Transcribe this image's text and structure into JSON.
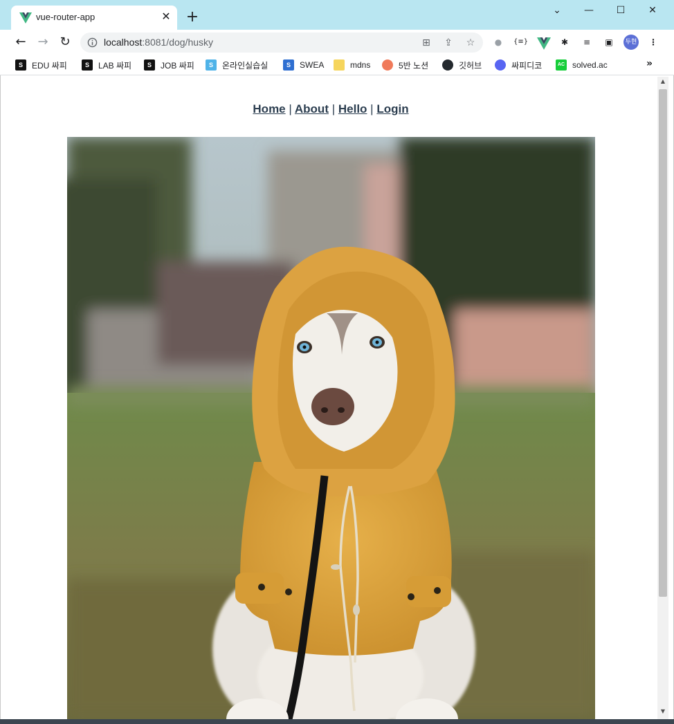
{
  "browser": {
    "tab": {
      "title": "vue-router-app",
      "close_label": "✕"
    },
    "new_tab_label": "+",
    "window_controls": {
      "minimize": "—",
      "maximize": "☐",
      "close": "✕",
      "dropdown": "⌄"
    },
    "url": {
      "host": "localhost",
      "rest": ":8081/dog/husky"
    },
    "profile_label": "두현",
    "bookmarks": [
      {
        "label": "EDU 싸피",
        "icon_color": "#111111",
        "icon_text": "S"
      },
      {
        "label": "LAB 싸피",
        "icon_color": "#111111",
        "icon_text": "S"
      },
      {
        "label": "JOB 싸피",
        "icon_color": "#111111",
        "icon_text": "S"
      },
      {
        "label": "온라인실습실",
        "icon_color": "#4fb3e8",
        "icon_text": "S"
      },
      {
        "label": "SWEA",
        "icon_color": "#2f6fd1",
        "icon_text": "S"
      },
      {
        "label": "mdns",
        "icon_color": "#f6d55c",
        "icon_text": ""
      },
      {
        "label": "5반 노션",
        "icon_color": "#f07a5a",
        "icon_text": ""
      },
      {
        "label": "깃허브",
        "icon_color": "#24292e",
        "icon_text": ""
      },
      {
        "label": "싸피디코",
        "icon_color": "#5865f2",
        "icon_text": ""
      },
      {
        "label": "solved.ac",
        "icon_color": "#17ce3a",
        "icon_text": "AC"
      }
    ],
    "bookmarks_more": "»"
  },
  "page": {
    "nav": [
      {
        "label": "Home"
      },
      {
        "label": "About"
      },
      {
        "label": "Hello"
      },
      {
        "label": "Login"
      }
    ],
    "separator": "|",
    "image_subject": "husky dog in yellow raincoat"
  },
  "colors": {
    "tabstrip": "#b9e6f1",
    "link": "#2c3e50",
    "raincoat": "#e0a83a"
  }
}
